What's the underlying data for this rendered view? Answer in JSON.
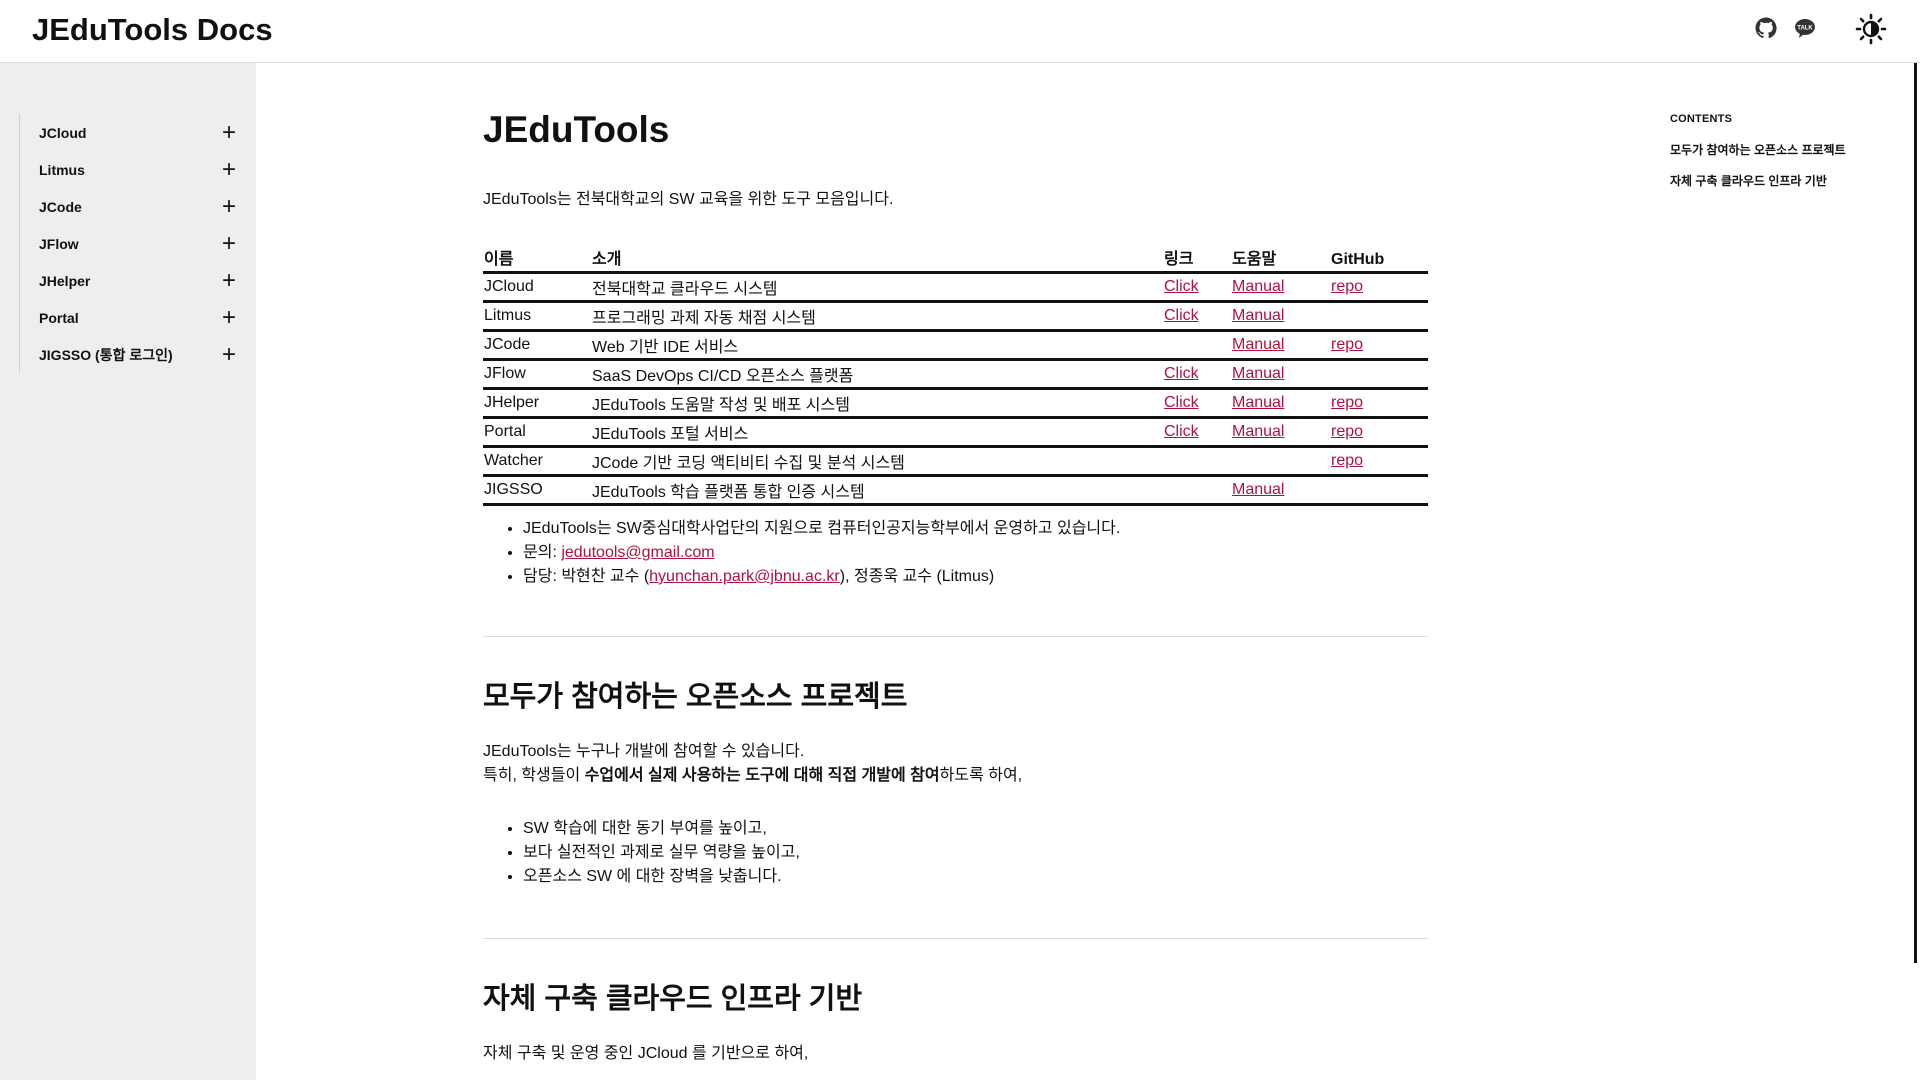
{
  "header": {
    "site_title": "JEduTools Docs",
    "icons": [
      "github-icon",
      "talk-icon",
      "theme-toggle-icon"
    ],
    "talk_label": "TALK"
  },
  "sidebar": {
    "items": [
      {
        "label": "JCloud"
      },
      {
        "label": "Litmus"
      },
      {
        "label": "JCode"
      },
      {
        "label": "JFlow"
      },
      {
        "label": "JHelper"
      },
      {
        "label": "Portal"
      },
      {
        "label": "JIGSSO (통합 로그인)"
      }
    ],
    "expand_symbol": "+"
  },
  "main": {
    "title": "JEduTools",
    "intro": "JEduTools는 전북대학교의 SW 교육을 위한 도구 모음입니다.",
    "table": {
      "headers": [
        "이름",
        "소개",
        "링크",
        "도움말",
        "GitHub"
      ],
      "rows": [
        {
          "name": "JCloud",
          "desc": "전북대학교 클라우드 시스템",
          "link": "Click",
          "manual": "Manual",
          "github": "repo"
        },
        {
          "name": "Litmus",
          "desc": "프로그래밍 과제 자동 채점 시스템",
          "link": "Click",
          "manual": "Manual",
          "github": ""
        },
        {
          "name": "JCode",
          "desc": "Web 기반 IDE 서비스",
          "link": "",
          "manual": "Manual",
          "github": "repo"
        },
        {
          "name": "JFlow",
          "desc": "SaaS DevOps CI/CD 오픈소스 플랫폼",
          "link": "Click",
          "manual": "Manual",
          "github": ""
        },
        {
          "name": "JHelper",
          "desc": "JEduTools 도움말 작성 및 배포 시스템",
          "link": "Click",
          "manual": "Manual",
          "github": "repo"
        },
        {
          "name": "Portal",
          "desc": "JEduTools 포털 서비스",
          "link": "Click",
          "manual": "Manual",
          "github": "repo"
        },
        {
          "name": "Watcher",
          "desc": "JCode 기반 코딩 액티비티 수집 및 분석 시스템",
          "link": "",
          "manual": "",
          "github": "repo"
        },
        {
          "name": "JIGSSO",
          "desc": "JEduTools 학습 플랫폼 통합 인증 시스템",
          "link": "",
          "manual": "Manual",
          "github": ""
        }
      ]
    },
    "info": {
      "operation": "JEduTools는 SW중심대학사업단의 지원으로 컴퓨터인공지능학부에서 운영하고 있습니다.",
      "contact_prefix": "문의: ",
      "contact_email": "jedutools@gmail.com",
      "manager_prefix": "담당: 박현찬 교수 (",
      "manager_email": "hyunchan.park@jbnu.ac.kr",
      "manager_suffix": "), 정종욱 교수 (Litmus)"
    },
    "section1": {
      "title": "모두가 참여하는 오픈소스 프로젝트",
      "line1": "JEduTools는 누구나 개발에 참여할 수 있습니다.",
      "line2_prefix": "특히, 학생들이 ",
      "line2_bold": "수업에서 실제 사용하는 도구에 대해 직접 개발에 참여",
      "line2_suffix": "하도록 하여,",
      "bullets": [
        "SW 학습에 대한 동기 부여를 높이고,",
        "보다 실전적인 과제로 실무 역량을 높이고,",
        "오픈소스 SW 에 대한 장벽을 낮춥니다."
      ]
    },
    "section2": {
      "title": "자체 구축 클라우드 인프라 기반",
      "line1": "자체 구축 및 운영 중인 JCloud 를 기반으로 하여,"
    }
  },
  "toc": {
    "title": "CONTENTS",
    "items": [
      "모두가 참여하는 오픈소스 프로젝트",
      "자체 구축 클라우드 인프라 기반"
    ]
  },
  "colors": {
    "link": "#b0123f",
    "sidebar_bg": "#eeeeee",
    "text": "#111111"
  }
}
